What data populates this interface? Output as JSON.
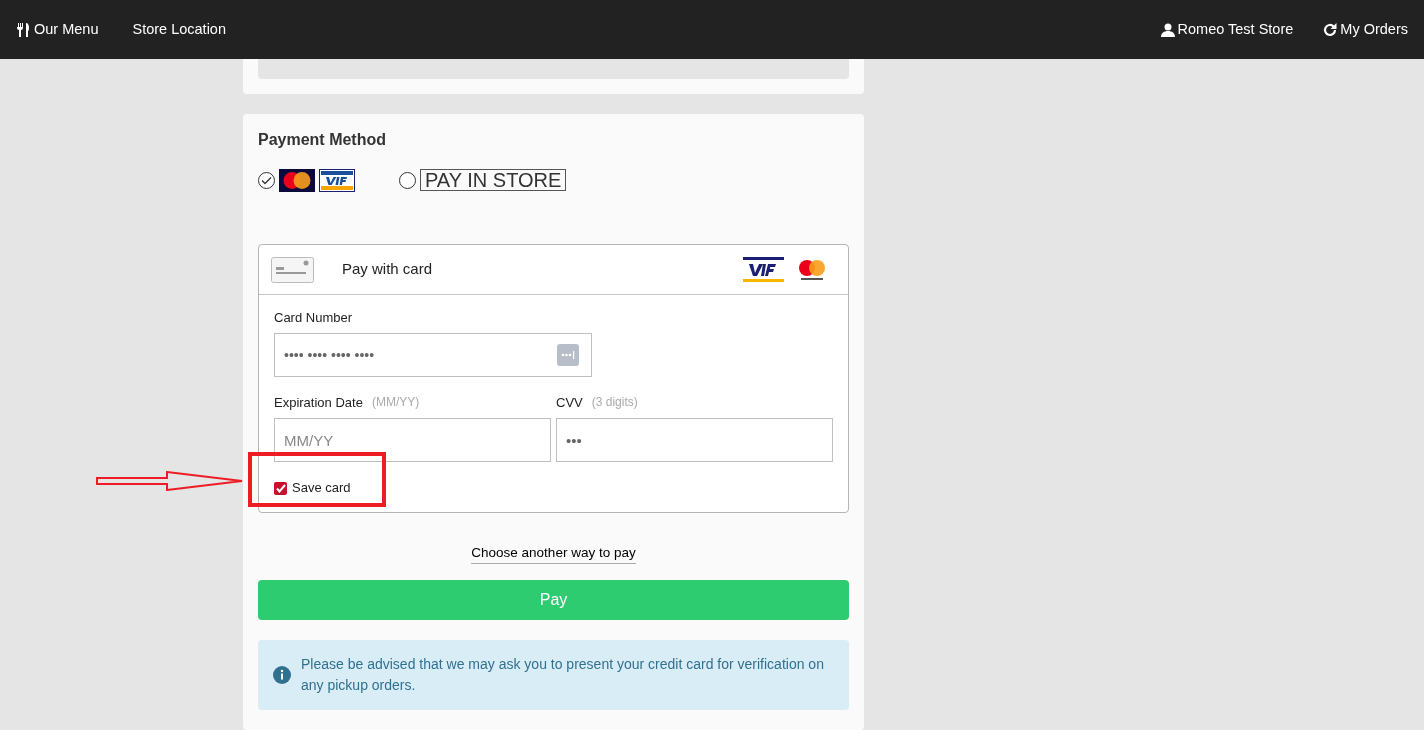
{
  "nav": {
    "left": [
      {
        "kind": "menu",
        "label": "Our Menu"
      },
      {
        "kind": "plain",
        "label": "Store Location"
      }
    ],
    "right": [
      {
        "kind": "user",
        "label": "Romeo Test Store"
      },
      {
        "kind": "orders",
        "label": "My Orders"
      }
    ]
  },
  "payment": {
    "title": "Payment Method",
    "options": [
      {
        "kind": "cards",
        "selected": true
      },
      {
        "kind": "text",
        "label": "PAY IN STORE",
        "selected": false
      }
    ],
    "card_form": {
      "header": "Pay with card",
      "card_number": {
        "label": "Card Number",
        "placeholder": "•••• •••• •••• ••••"
      },
      "expiration": {
        "label": "Expiration Date",
        "hint": "(MM/YY)",
        "placeholder": "MM/YY"
      },
      "cvv": {
        "label": "CVV",
        "hint": "(3 digits)",
        "placeholder": "•••"
      },
      "save_card": {
        "label": "Save card",
        "checked": true
      }
    },
    "other_way_link": "Choose another way to pay",
    "pay_button": "Pay",
    "notice": "Please be advised that we may ask you to present your credit card for verification on any pickup orders."
  }
}
